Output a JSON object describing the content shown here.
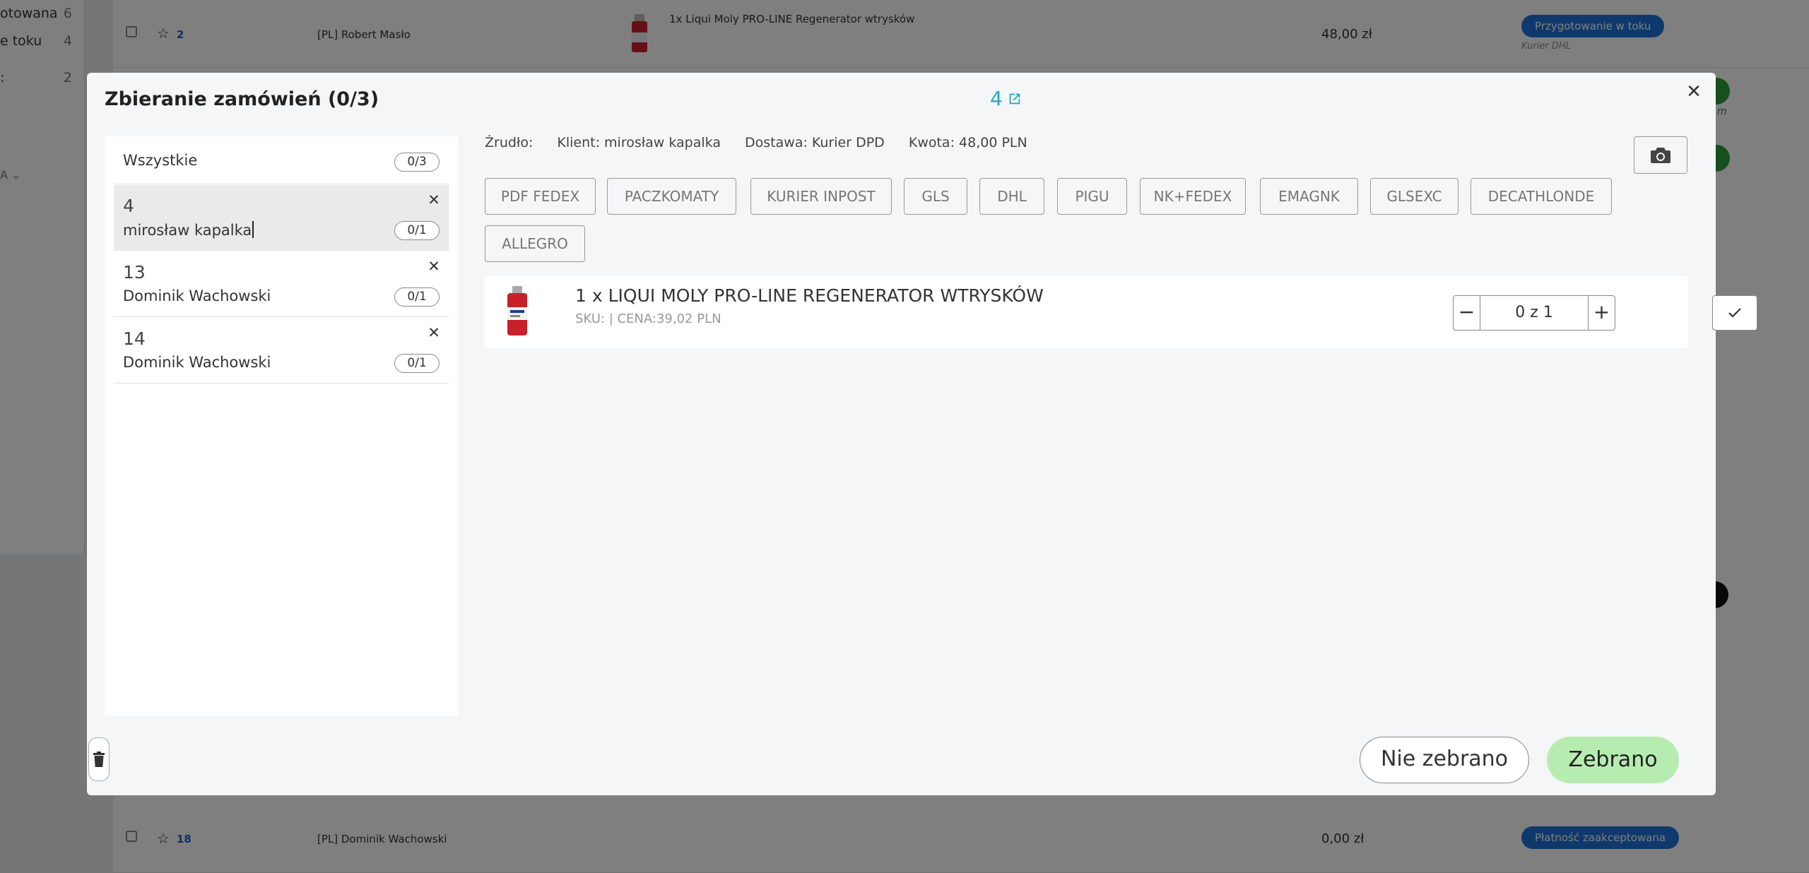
{
  "background": {
    "sidebar": [
      {
        "label": "otowana",
        "count": "6"
      },
      {
        "label": "e toku",
        "count": "4"
      },
      {
        "label": ":",
        "count": "2"
      }
    ],
    "sidebar_select": "A",
    "rows": [
      {
        "id": "2",
        "customer": "[PL] Robert Masło",
        "product": "1x Liqui Moly PRO-LINE Regenerator wtrysków",
        "amount": "48,00 zł",
        "status": "Przygotowanie w toku",
        "courier": "Kurier DHL"
      },
      {
        "id": "18",
        "customer": "[PL] Dominik Wachowski",
        "product": "",
        "amount": "0,00 zł",
        "status": "Płatność zaakceptowana",
        "courier": ""
      }
    ],
    "right_fragment": "m"
  },
  "modal": {
    "title": "Zbieranie zamówień (0/3)",
    "order_link": "4",
    "list": [
      {
        "name": "Wszystkie",
        "count": "0/3"
      },
      {
        "num": "4",
        "name": "mirosław kapalka",
        "count": "0/1"
      },
      {
        "num": "13",
        "name": "Dominik Wachowski",
        "count": "0/1"
      },
      {
        "num": "14",
        "name": "Dominik Wachowski",
        "count": "0/1"
      }
    ],
    "info": {
      "source": "Żrudło:",
      "client": "Klient: mirosław kapalka",
      "delivery": "Dostawa: Kurier DPD",
      "amount": "Kwota: 48,00 PLN"
    },
    "shipping_buttons": [
      "PDF FEDEX",
      "PACZKOMATY",
      "KURIER INPOST",
      "GLS",
      "DHL",
      "PIGU",
      "NK+FEDEX",
      "EMAGNK",
      "GLSEXC",
      "DECATHLONDE",
      "ALLEGRO"
    ],
    "product": {
      "name": "1 x LIQUI MOLY PRO-LINE REGENERATOR WTRYSKÓW",
      "sku_line": "SKU: | CENA:39,02 PLN",
      "quantity": "0 z 1"
    },
    "buttons": {
      "not_collected": "Nie zebrano",
      "collected": "Zebrano"
    }
  },
  "icons": {
    "close": "close-icon",
    "external": "external-link-icon",
    "camera": "camera-icon",
    "check": "check-icon",
    "trash": "trash-icon"
  },
  "colors": {
    "status_blue": "#1e73d8",
    "link_teal": "#2aa7c0",
    "collected_green": "#b7ecb0"
  }
}
